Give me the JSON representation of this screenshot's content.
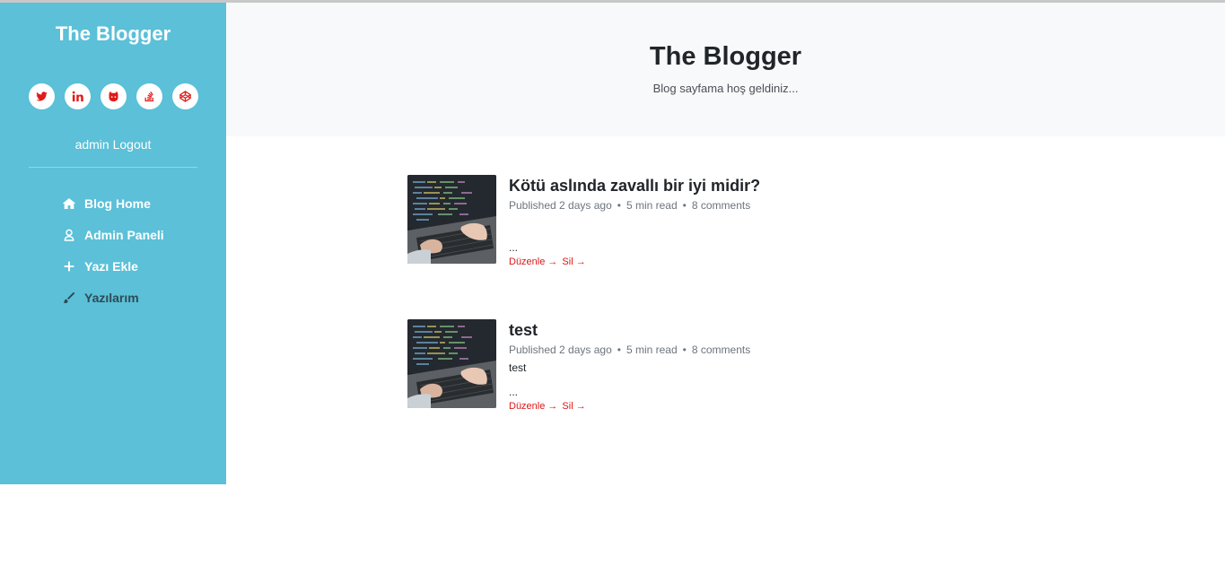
{
  "sidebar": {
    "brand": "The Blogger",
    "social": [
      "twitter-icon",
      "linkedin-icon",
      "github-icon",
      "stackoverflow-icon",
      "codepen-icon"
    ],
    "user": {
      "name": "admin",
      "logout": "Logout"
    },
    "nav": [
      {
        "label": "Blog Home",
        "icon": "home-icon"
      },
      {
        "label": "Admin Paneli",
        "icon": "user-icon"
      },
      {
        "label": "Yazı Ekle",
        "icon": "plus-icon"
      },
      {
        "label": "Yazılarım",
        "icon": "brush-icon"
      }
    ]
  },
  "header": {
    "title": "The Blogger",
    "subtitle": "Blog sayfama hoş geldiniz..."
  },
  "posts": [
    {
      "title": "Kötü aslında zavallı bir iyi midir?",
      "published": "Published 2 days ago",
      "read": "5 min read",
      "comments": "8 comments",
      "excerpt": "",
      "ellipsis": "...",
      "edit": "Düzenle →",
      "delete": "Sil →"
    },
    {
      "title": "test",
      "published": "Published 2 days ago",
      "read": "5 min read",
      "comments": "8 comments",
      "excerpt": "test",
      "ellipsis": "...",
      "edit": "Düzenle →",
      "delete": "Sil →"
    }
  ],
  "colors": {
    "sidebar_bg": "#5bc0d8",
    "accent_red": "#dc1717",
    "header_bg": "#f8f9fa"
  }
}
